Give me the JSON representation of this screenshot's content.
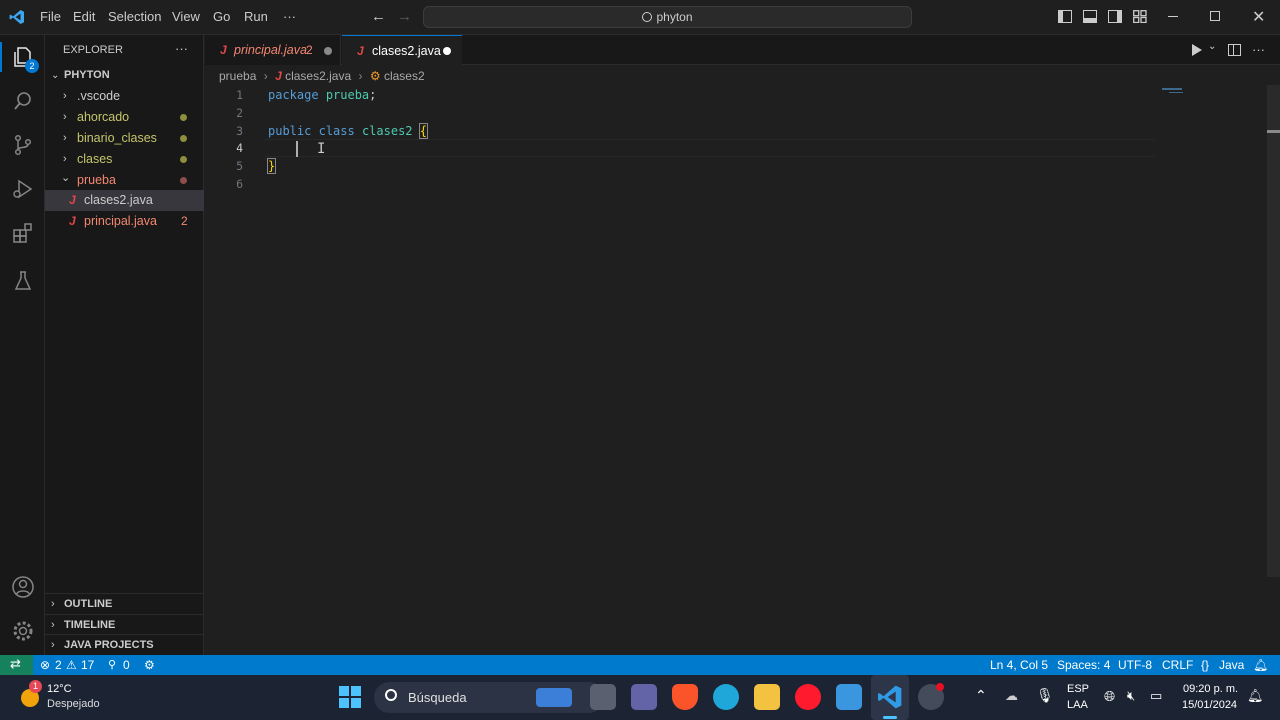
{
  "titlebar": {
    "menus": [
      "File",
      "Edit",
      "Selection",
      "View",
      "Go",
      "Run",
      "···"
    ],
    "search_text": "phyton"
  },
  "activitybar": {
    "explorer_badge": "2"
  },
  "sidebar": {
    "header": "EXPLORER",
    "more": "···",
    "folder": "PHYTON",
    "items": [
      {
        "label": ".vscode",
        "color": "#cccccc"
      },
      {
        "label": "ahorcado",
        "color": "#c5c56b"
      },
      {
        "label": "binario_clases",
        "color": "#c5c56b"
      },
      {
        "label": "clases",
        "color": "#c5c56b"
      },
      {
        "label": "prueba",
        "color": "#f48771"
      },
      {
        "label": "clases2.java",
        "color": "#cccccc"
      },
      {
        "label": "principal.java",
        "color": "#f48771",
        "badge": "2"
      }
    ],
    "sections": [
      "OUTLINE",
      "TIMELINE",
      "JAVA PROJECTS"
    ]
  },
  "editor": {
    "tabs": [
      {
        "label": "principal.java",
        "badge": "2"
      },
      {
        "label": "clases2.java"
      }
    ],
    "breadcrumb": [
      "prueba",
      "clases2.java",
      "clases2"
    ],
    "line_numbers": [
      "1",
      "2",
      "3",
      "4",
      "5",
      "6"
    ],
    "code": {
      "line1_kw": "package",
      "line1_name": "prueba",
      "line1_end": ";",
      "line3_kw1": "public",
      "line3_kw2": "class",
      "line3_name": "clases2",
      "line3_brace": "{",
      "line5_brace": "}"
    }
  },
  "statusbar": {
    "errors": "2",
    "warnings": "17",
    "ports": "0",
    "position": "Ln 4, Col 5",
    "spaces": "Spaces: 4",
    "encoding": "UTF-8",
    "eol": "CRLF",
    "language": "Java"
  },
  "taskbar": {
    "weather_temp": "12°C",
    "weather_desc": "Despejado",
    "weather_badge": "1",
    "search_placeholder": "Búsqueda",
    "lang_top": "ESP",
    "lang_bottom": "LAA",
    "time": "09:20 p. m.",
    "date": "15/01/2024"
  }
}
